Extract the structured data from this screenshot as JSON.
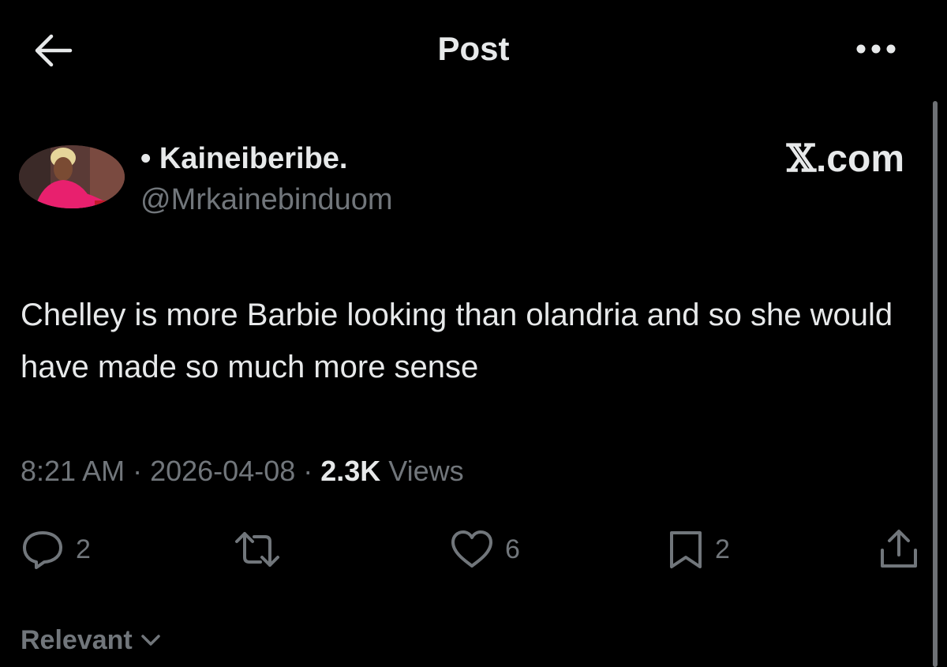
{
  "header": {
    "title": "Post",
    "back_icon": "arrow-left-icon",
    "more_icon": "more-horizontal-icon"
  },
  "author": {
    "name": "• Kaineiberibe.",
    "handle": "@Mrkainebinduom",
    "avatar_icon": "avatar-photo"
  },
  "brand": {
    "x_glyph": "𝕏",
    "suffix": ".com"
  },
  "post": {
    "text": "Chelley is more Barbie looking than olandria and so she would have made so much more sense"
  },
  "meta": {
    "time": "8:21 AM",
    "sep1": " · ",
    "date": "2026-04-08",
    "sep2": " · ",
    "views_count": "2.3K",
    "views_label": " Views"
  },
  "actions": {
    "reply": {
      "icon": "reply-bubble-icon",
      "count": "2"
    },
    "repost": {
      "icon": "repost-icon",
      "count": ""
    },
    "like": {
      "icon": "heart-icon",
      "count": "6"
    },
    "bookmark": {
      "icon": "bookmark-icon",
      "count": "2"
    },
    "share": {
      "icon": "share-icon",
      "count": ""
    }
  },
  "sort": {
    "label": "Relevant",
    "icon": "chevron-down-icon"
  },
  "colors": {
    "background": "#000000",
    "primary_text": "#e7e9ea",
    "secondary_text": "#71767b",
    "avatar_pink": "#e8206e"
  }
}
